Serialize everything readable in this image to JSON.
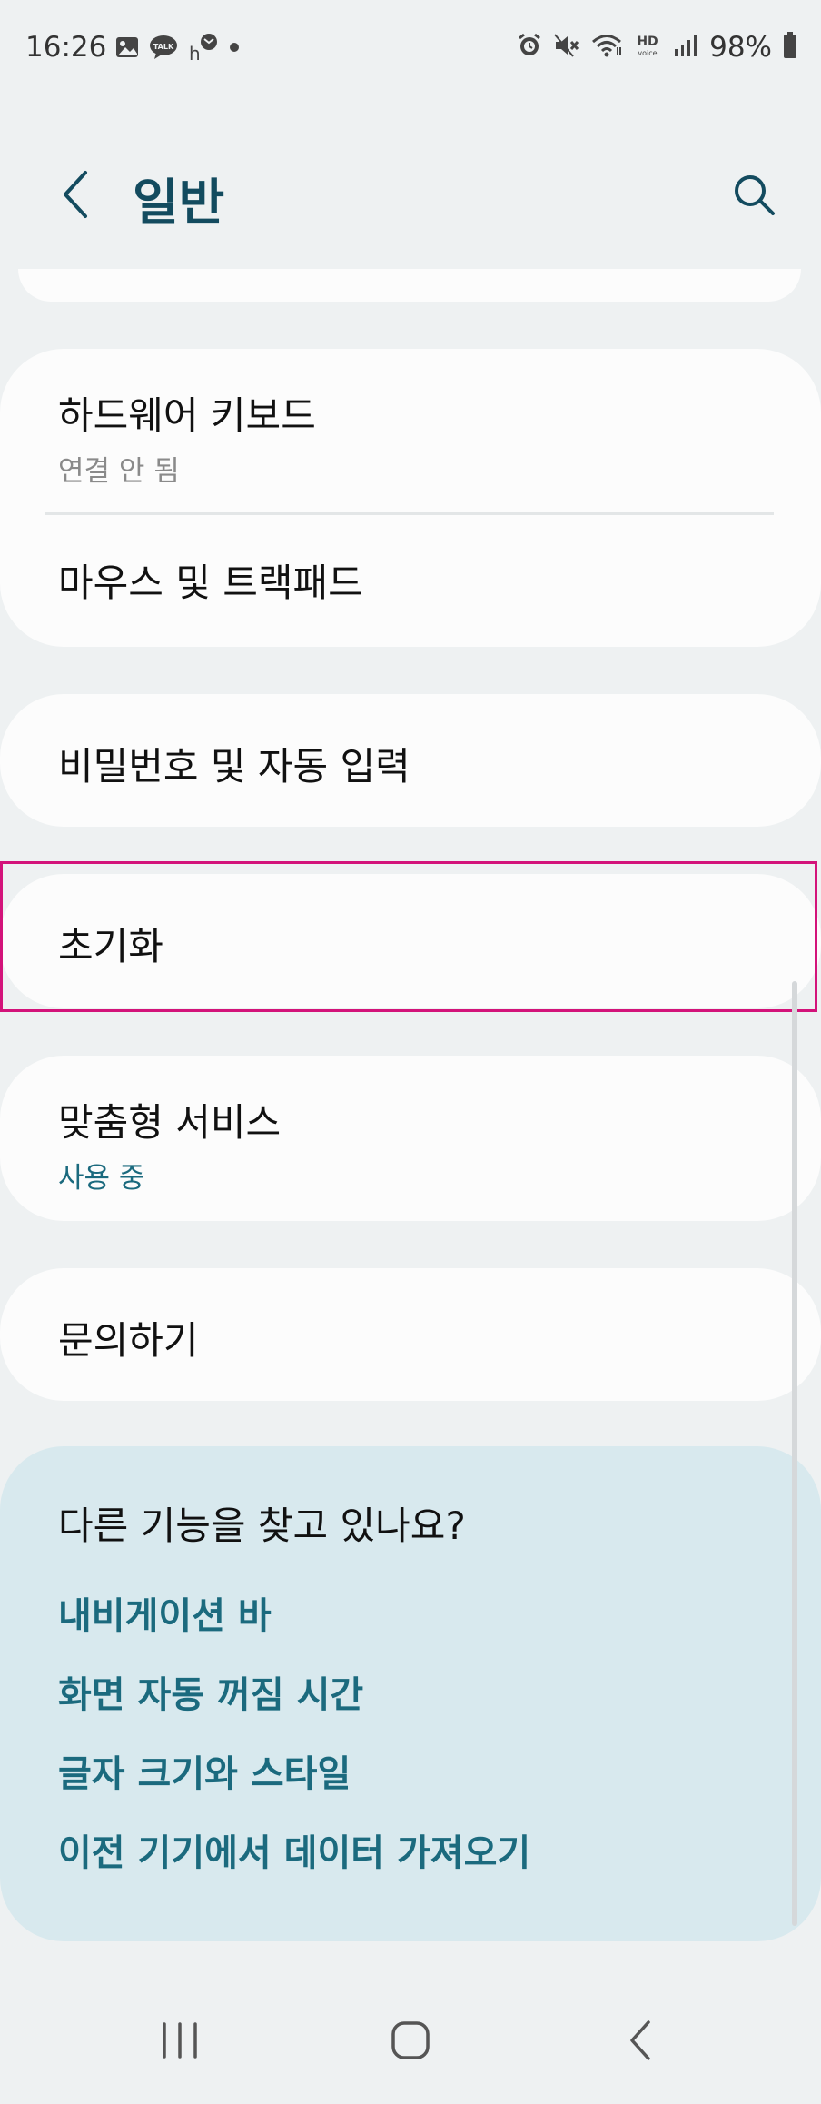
{
  "status_bar": {
    "time": "16:26",
    "battery": "98%",
    "left_icons": [
      "gallery-icon",
      "talk-icon",
      "naver-icon",
      "dot-icon"
    ],
    "right_icons": [
      "alarm-icon",
      "mute-icon",
      "wifi-icon",
      "hd-voice-icon",
      "signal-icon",
      "battery-icon"
    ]
  },
  "header": {
    "title": "일반"
  },
  "cards": {
    "hardware_keyboard": {
      "title": "하드웨어 키보드",
      "subtitle": "연결 안 됨"
    },
    "mouse_trackpad": {
      "title": "마우스 및 트랙패드"
    },
    "password_autofill": {
      "title": "비밀번호 및 자동 입력"
    },
    "reset": {
      "title": "초기화"
    },
    "custom_service": {
      "title": "맞춤형 서비스",
      "subtitle": "사용 중"
    },
    "contact_us": {
      "title": "문의하기"
    }
  },
  "suggestions": {
    "heading": "다른 기능을 찾고 있나요?",
    "links": [
      "내비게이션 바",
      "화면 자동 꺼짐 시간",
      "글자 크기와 스타일",
      "이전 기기에서 데이터 가져오기"
    ]
  },
  "colors": {
    "background": "#eef1f2",
    "card": "#fcfcfc",
    "title_accent": "#134b5f",
    "link_accent": "#1b6a7e",
    "suggest_bg": "#d8e9ee",
    "highlight": "#d3137a"
  },
  "nav_bar": {
    "icons": [
      "recent-apps-icon",
      "home-icon",
      "back-icon"
    ]
  }
}
